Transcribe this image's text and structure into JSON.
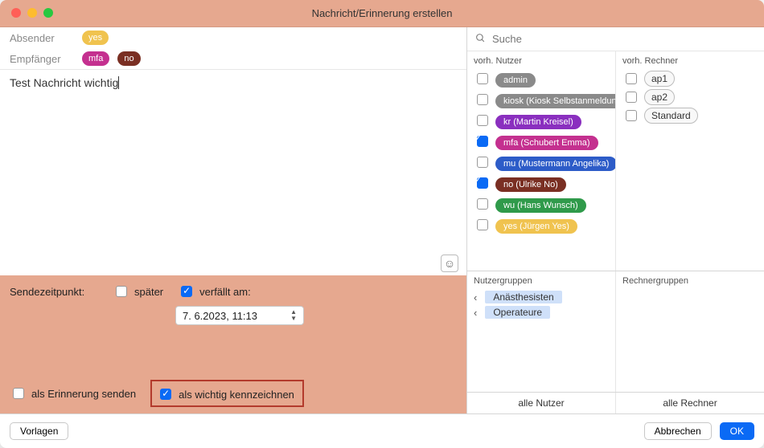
{
  "window": {
    "title": "Nachricht/Erinnerung erstellen"
  },
  "header": {
    "sender_label": "Absender",
    "sender_tag": "yes",
    "recipient_label": "Empfänger",
    "recipient_tags": [
      "mfa",
      "no"
    ]
  },
  "message": {
    "text": "Test Nachricht wichtig"
  },
  "options": {
    "sendtime_label": "Sendezeitpunkt:",
    "later_label": "später",
    "later_checked": false,
    "expires_label": "verfällt am:",
    "expires_checked": true,
    "expires_value": "7.  6.2023, 11:13",
    "as_reminder_label": "als Erinnerung senden",
    "as_reminder_checked": false,
    "as_important_label": "als wichtig kennzeichnen",
    "as_important_checked": true
  },
  "search": {
    "placeholder": "Suche"
  },
  "users": {
    "header": "vorh. Nutzer",
    "items": [
      {
        "name": "admin",
        "color": "#8a8a8a",
        "checked": false
      },
      {
        "name": "kiosk (Kiosk Selbstanmeldung)",
        "color": "#8a8a8a",
        "checked": false
      },
      {
        "name": "kr (Martin Kreisel)",
        "color": "#8a2fbf",
        "checked": false
      },
      {
        "name": "mfa (Schubert Emma)",
        "color": "#c4308f",
        "checked": true
      },
      {
        "name": "mu (Mustermann Angelika)",
        "color": "#2d5cc8",
        "checked": false
      },
      {
        "name": "no (Ulrike No)",
        "color": "#7a2f23",
        "checked": true
      },
      {
        "name": "wu (Hans Wunsch)",
        "color": "#2f9a4a",
        "checked": false
      },
      {
        "name": "yes (Jürgen Yes)",
        "color": "#f0c34f",
        "checked": false
      }
    ]
  },
  "machines": {
    "header": "vorh. Rechner",
    "items": [
      "ap1",
      "ap2",
      "Standard"
    ]
  },
  "user_groups": {
    "header": "Nutzergruppen",
    "items": [
      "Anästhesisten",
      "Operateure"
    ]
  },
  "machine_groups": {
    "header": "Rechnergruppen",
    "items": []
  },
  "all_row": {
    "users": "alle Nutzer",
    "machines": "alle Rechner"
  },
  "footer": {
    "templates": "Vorlagen",
    "cancel": "Abbrechen",
    "ok": "OK"
  }
}
